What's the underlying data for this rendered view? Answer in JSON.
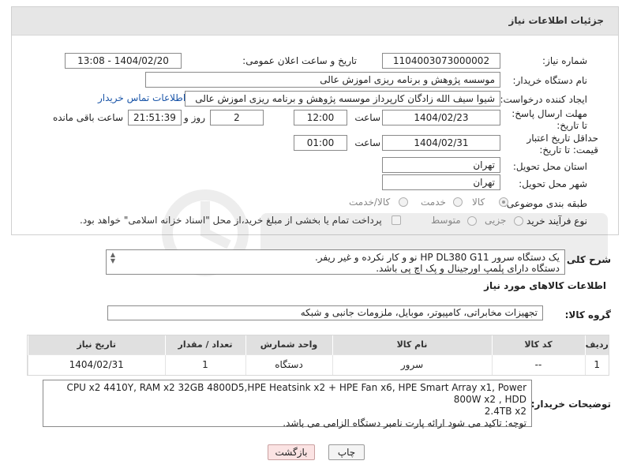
{
  "panel": {
    "title": "جزئیات اطلاعات نیاز"
  },
  "fields": {
    "need_number_label": "شماره نیاز:",
    "need_number": "1104003073000002",
    "announce_label": "تاریخ و ساعت اعلان عمومی:",
    "announce_value": "1404/02/20 - 13:08",
    "buyer_org_label": "نام دستگاه خریدار:",
    "buyer_org": "موسسه پژوهش و برنامه ریزی اموزش عالی",
    "creator_label": "ایجاد کننده درخواست:",
    "creator": "شیوا سیف الله زادگان کارپرداز موسسه پژوهش و برنامه ریزی اموزش عالی",
    "buyer_contact_link": "اطلاعات تماس خریدار",
    "deadline_label": "مهلت ارسال پاسخ: تا تاریخ:",
    "deadline_date": "1404/02/23",
    "time_word": "ساعت",
    "deadline_time": "12:00",
    "days": "2",
    "days_word": "روز و",
    "remaining": "21:51:39",
    "remaining_word": "ساعت باقی مانده",
    "validity_label": "حداقل تاریخ اعتبار قیمت: تا تاریخ:",
    "validity_date": "1404/02/31",
    "validity_time": "01:00",
    "province_label": "استان محل تحویل:",
    "province": "تهران",
    "city_label": "شهر محل تحویل:",
    "city": "تهران",
    "category_label": "طبقه بندی موضوعی:",
    "category_options": [
      "کالا",
      "خدمت",
      "کالا/خدمت"
    ],
    "process_label": "نوع فرآیند خرید :",
    "process_options": [
      "جزیی",
      "متوسط"
    ],
    "payment_note": "پرداخت تمام یا بخشی از مبلغ خرید،از محل \"اسناد خزانه اسلامی\" خواهد بود."
  },
  "description": {
    "label": "شرح کلی نیاز:",
    "line1": "یک دستگاه سرور HP DL380 G11 نو و کار نکرده و غیر ریفر.",
    "line2": "دستگاه دارای پلمپ اورجینال و پک اچ پی باشد."
  },
  "goods_info_title": "اطلاعات کالاهای مورد نیاز",
  "goods_group": {
    "label": "گروه کالا:",
    "value": "تجهیزات مخابراتی، کامپیوتر، موبایل، ملزومات جانبی و شبکه"
  },
  "table": {
    "headers": [
      "ردیف",
      "کد کالا",
      "نام کالا",
      "واحد شمارش",
      "تعداد / مقدار",
      "تاریخ نیاز"
    ],
    "rows": [
      [
        "1",
        "--",
        "سرور",
        "دستگاه",
        "1",
        "1404/02/31"
      ]
    ]
  },
  "buyer_notes": {
    "label": "توضیحات خریدار:",
    "line1": "CPU x2 4410Y, RAM x2 32GB 4800D5,HPE Heatsink x2 + HPE Fan x6, HPE Smart Array x1, Power 800W x2 , HDD",
    "line2": "2.4TB x2",
    "line3": "توجه: تاکید می شود ارائه پارت نامبر دستگاه الزامی می باشد."
  },
  "buttons": {
    "print": "چاپ",
    "back": "بازگشت"
  },
  "colors": {
    "header_bg": "#e6e6e6",
    "link": "#1a55a8",
    "back_button_bg": "#fbe3e3"
  }
}
